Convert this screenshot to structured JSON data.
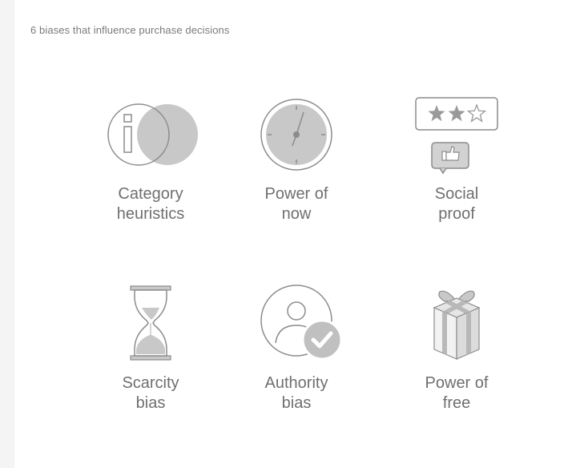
{
  "heading": "6 biases that influence purchase decisions",
  "colors": {
    "icon_fill": "#c8c8c8",
    "icon_stroke": "#8c8c8c",
    "label_text": "#6f6f6f",
    "heading_text": "#7a7a7a"
  },
  "biases": [
    {
      "icon": "category-heuristics-icon",
      "line1": "Category",
      "line2": "heuristics"
    },
    {
      "icon": "clock-icon",
      "line1": "Power of",
      "line2": "now"
    },
    {
      "icon": "review-stars-thumbs-up-icon",
      "line1": "Social",
      "line2": "proof"
    },
    {
      "icon": "hourglass-icon",
      "line1": "Scarcity",
      "line2": "bias"
    },
    {
      "icon": "verified-user-icon",
      "line1": "Authority",
      "line2": "bias"
    },
    {
      "icon": "gift-box-icon",
      "line1": "Power of",
      "line2": "free"
    }
  ]
}
